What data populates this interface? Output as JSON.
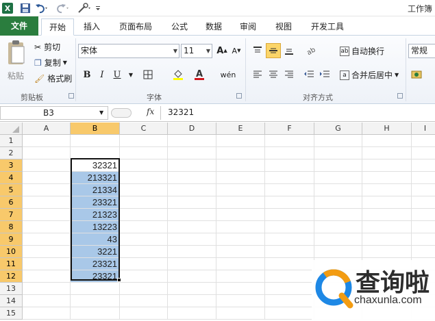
{
  "window": {
    "title": "工作簿"
  },
  "tabs": [
    {
      "label": "文件"
    },
    {
      "label": "开始"
    },
    {
      "label": "插入"
    },
    {
      "label": "页面布局"
    },
    {
      "label": "公式"
    },
    {
      "label": "数据"
    },
    {
      "label": "审阅"
    },
    {
      "label": "视图"
    },
    {
      "label": "开发工具"
    }
  ],
  "ribbon": {
    "clipboard": {
      "paste": "粘贴",
      "cut": "剪切",
      "copy": "复制",
      "format_painter": "格式刷",
      "group": "剪贴板"
    },
    "font": {
      "name": "宋体",
      "size": "11",
      "group": "字体",
      "bold": "B",
      "italic": "I",
      "underline": "U"
    },
    "alignment": {
      "wrap_text": "自动换行",
      "merge_center": "合并后居中",
      "group": "对齐方式"
    },
    "number": {
      "format": "常规"
    }
  },
  "formula_bar": {
    "name_box": "B3",
    "fx": "fx",
    "value": "32321"
  },
  "columns": [
    "A",
    "B",
    "C",
    "D",
    "E",
    "F",
    "G",
    "H",
    "I"
  ],
  "rows": [
    "1",
    "2",
    "3",
    "4",
    "5",
    "6",
    "7",
    "8",
    "9",
    "10",
    "11",
    "12",
    "13",
    "14",
    "15"
  ],
  "cells_b": [
    "",
    "",
    "32321",
    "213321",
    "21334",
    "23321",
    "21323",
    "13223",
    "43",
    "3221",
    "23321",
    "23321",
    "",
    "",
    ""
  ],
  "watermark": {
    "brand": "查询啦",
    "url": "chaxunla.com"
  },
  "colors": {
    "file_tab": "#2a7d3e",
    "selection_fill": "#a9c8e8",
    "header_highlight": "#f8c96b"
  }
}
